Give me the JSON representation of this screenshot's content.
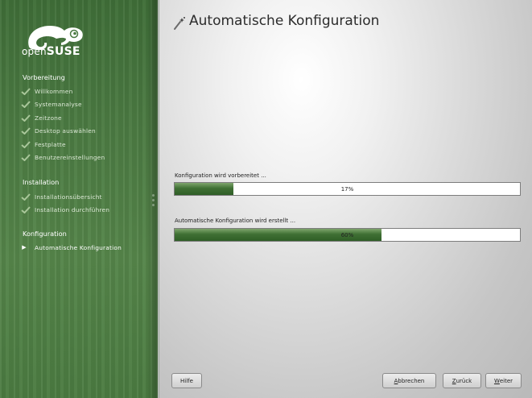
{
  "logo": {
    "text_prefix": "open",
    "text_brand": "SUSE"
  },
  "sidebar": {
    "sections": [
      {
        "title": "Vorbereitung",
        "steps": [
          "Willkommen",
          "Systemanalyse",
          "Zeitzone",
          "Desktop auswählen",
          "Festplatte",
          "Benutzereinstellungen"
        ]
      },
      {
        "title": "Installation",
        "steps": [
          "Installationsübersicht",
          "Installation durchführen"
        ]
      },
      {
        "title": "Konfiguration",
        "steps": [
          "Automatische Konfiguration"
        ]
      }
    ],
    "icons": {
      "done": "check-icon",
      "current": "arrow-right-icon"
    }
  },
  "main": {
    "title": "Automatische Konfiguration",
    "title_icon": "magic-wand-icon",
    "progress": [
      {
        "label": "Konfiguration wird vorbereitet ...",
        "percent": 17,
        "percent_text": "17%"
      },
      {
        "label": "Automatische Konfiguration wird erstellt ...",
        "percent": 60,
        "percent_text": "60%"
      }
    ]
  },
  "buttons": {
    "help": "Hilfe",
    "abort_mnemonic": "A",
    "abort_rest": "bbrechen",
    "back_mnemonic": "Z",
    "back_rest": "urück",
    "next_mnemonic": "W",
    "next_rest": "eiter"
  },
  "colors": {
    "sidebar": "#4b7a42",
    "progress_fill": "#3f7034",
    "accent": "#6da741"
  }
}
